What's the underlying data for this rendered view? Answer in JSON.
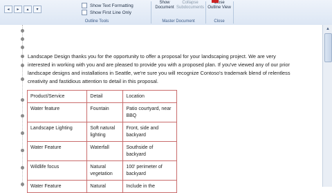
{
  "ribbon": {
    "outline_tools": {
      "label": "Outline Tools",
      "show_text_formatting": "Show Text Formatting",
      "show_first_line_only": "Show First Line Only"
    },
    "master_document": {
      "label": "Master Document",
      "show_document_l1": "Show",
      "show_document_l2": "Document",
      "collapse_l1": "Collapse",
      "collapse_l2": "Subdocuments"
    },
    "close": {
      "label": "Close",
      "close_view_l1": "Close",
      "close_view_l2": "Outline View"
    }
  },
  "document": {
    "paragraph": "Landscape Design thanks you for the opportunity to offer a proposal for your landscaping project. We are very interested in working with you and are pleased to provide you with a proposed plan. If you've viewed any of our prior landscape designs and installations in Seattle, we're sure you will recognize Contoso's trademark blend of relentless creativity and fastidious attention to detail in this proposal.",
    "table": {
      "headers": [
        "Product/Service",
        "Detail",
        "Location"
      ],
      "rows": [
        [
          "Water feature",
          "Fountain",
          "Patio courtyard, near BBQ"
        ],
        [
          "Landscape Lighting",
          "Soft natural lighting",
          "Front, side and backyard"
        ],
        [
          "Water Feature",
          "Waterfall",
          "Southside of backyard"
        ],
        [
          "Wildlife focus",
          "Natural vegetation",
          "100' perimeter of backyard"
        ],
        [
          "Water Feature",
          "Natural",
          "Include in the"
        ]
      ]
    }
  },
  "colors": {
    "table_border": "#c96b6b",
    "ribbon_bg": "#dce6f4",
    "close_accent": "#cc2222"
  }
}
